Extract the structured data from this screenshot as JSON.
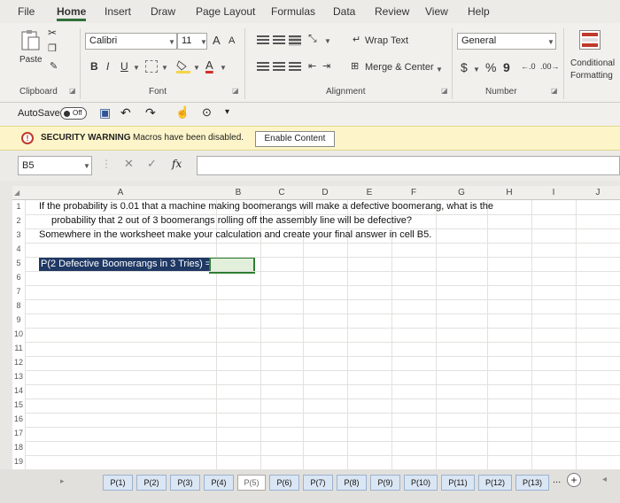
{
  "menu": {
    "tabs": [
      "File",
      "Home",
      "Insert",
      "Draw",
      "Page Layout",
      "Formulas",
      "Data",
      "Review",
      "View",
      "Help"
    ],
    "active": "Home"
  },
  "ribbon": {
    "paste_label": "Paste",
    "font_name": "Calibri",
    "font_size": "11",
    "grow_font": "A",
    "shrink_font": "A",
    "bold": "B",
    "italic": "I",
    "underline": "U",
    "font_color_letter": "A",
    "wrap_text": "Wrap Text",
    "merge_center": "Merge & Center",
    "number_format": "General",
    "currency": "$",
    "percent": "%",
    "comma": "9",
    "conditional_formatting_line1": "Conditional",
    "conditional_formatting_line2": "Formatting",
    "groups": {
      "clipboard": "Clipboard",
      "font": "Font",
      "alignment": "Alignment",
      "number": "Number"
    },
    "accent_fill_color": "#f5d547",
    "accent_font_color": "#d32f2f"
  },
  "qat": {
    "autosave_label": "AutoSave",
    "autosave_state": "Off"
  },
  "security": {
    "title": "SECURITY WARNING",
    "message": "Macros have been disabled.",
    "button": "Enable Content"
  },
  "formula_bar": {
    "name_box": "B5",
    "fx": "fx",
    "value": ""
  },
  "grid": {
    "columns": [
      "A",
      "B",
      "C",
      "D",
      "E",
      "F",
      "G",
      "H",
      "I",
      "J"
    ],
    "rows": [
      "1",
      "2",
      "3",
      "4",
      "5",
      "6",
      "7",
      "8",
      "9",
      "10",
      "11",
      "12",
      "13",
      "14",
      "15",
      "16",
      "17",
      "18",
      "19"
    ],
    "row1": "If the probability is 0.01 that a machine making boomerangs will make a defective boomerang, what is the",
    "row2": "probability that 2 out of 3 boomerangs rolling off the assembly line will be defective?",
    "row3": "Somewhere in the worksheet make your calculation and create your final answer in cell B5.",
    "a5": "P(2 Defective Boomerangs in 3 Tries) ="
  },
  "sheets": {
    "tabs": [
      "P(1)",
      "P(2)",
      "P(3)",
      "P(4)",
      "P(5)",
      "P(6)",
      "P(7)",
      "P(8)",
      "P(9)",
      "P(10)",
      "P(11)",
      "P(12)",
      "P(13)"
    ],
    "active": "P(5)",
    "more": "...",
    "add": "+"
  }
}
